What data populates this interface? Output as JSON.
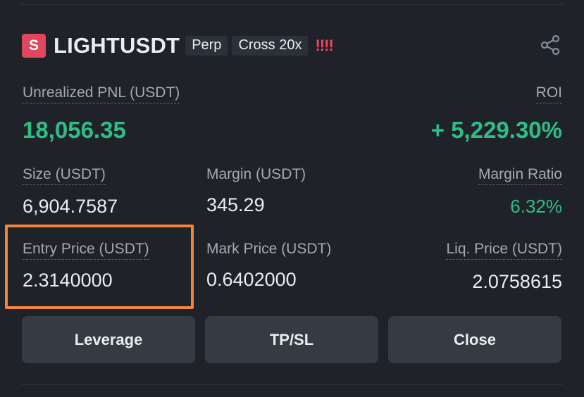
{
  "position": {
    "symbol": "LIGHTUSDT",
    "coin_letter": "S",
    "contract_type": "Perp",
    "margin_mode": "Cross 20x",
    "risk_indicator": "!!!!",
    "unrealized_pnl_label": "Unrealized PNL (USDT)",
    "unrealized_pnl": "18,056.35",
    "roi_label": "ROI",
    "roi": "+ 5,229.30%",
    "size_label": "Size (USDT)",
    "size": "6,904.7587",
    "margin_label": "Margin (USDT)",
    "margin": "345.29",
    "margin_ratio_label": "Margin Ratio",
    "margin_ratio": "6.32%",
    "entry_price_label": "Entry Price (USDT)",
    "entry_price": "2.3140000",
    "mark_price_label": "Mark Price (USDT)",
    "mark_price": "0.6402000",
    "liq_price_label": "Liq. Price (USDT)",
    "liq_price": "2.0758615"
  },
  "buttons": {
    "leverage": "Leverage",
    "tpsl": "TP/SL",
    "close": "Close"
  },
  "colors": {
    "background": "#1f2329",
    "profit_green": "#2ebd85",
    "warning_red": "#f6465d",
    "highlight_orange": "#f4833d",
    "coin_badge": "#e0465e"
  },
  "icons": {
    "share": "share-icon",
    "coin": "coin-icon"
  }
}
